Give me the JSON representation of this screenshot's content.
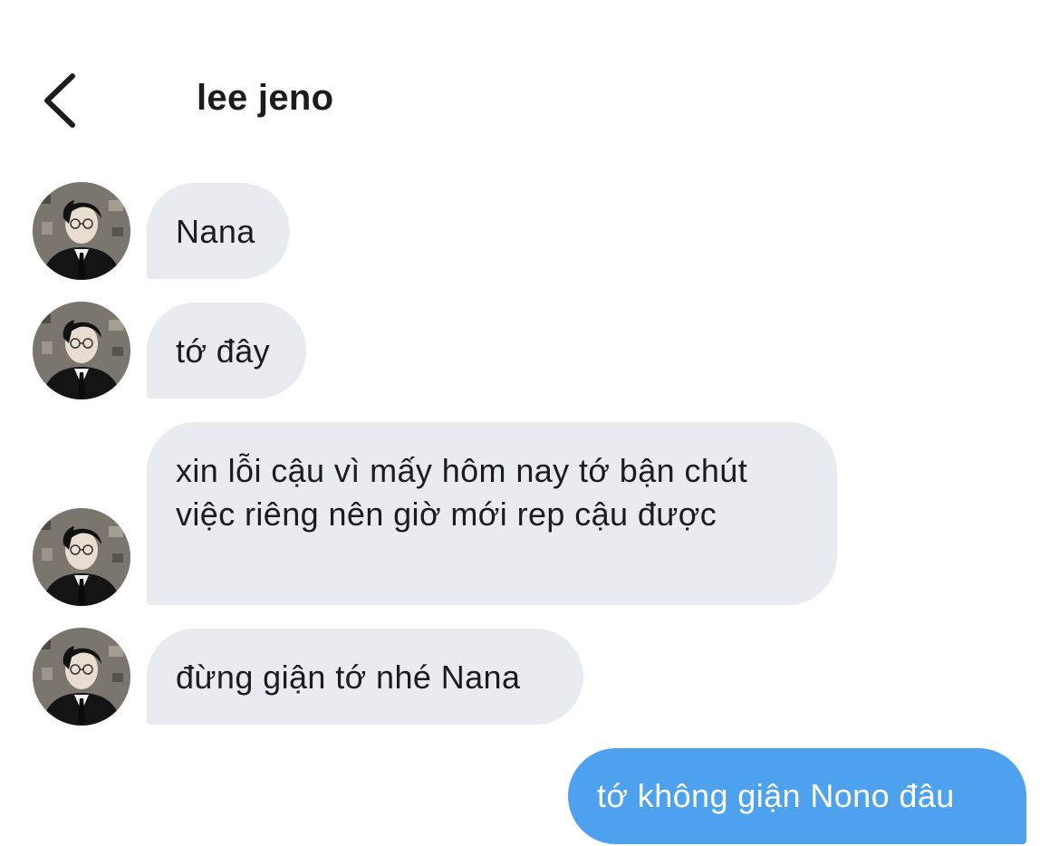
{
  "header": {
    "back_icon": "chevron-left-icon",
    "contact_name": "lee jeno"
  },
  "messages": [
    {
      "from": "contact",
      "text": "Nana",
      "avatar": "avatar-photo"
    },
    {
      "from": "contact",
      "text": "tớ đây",
      "avatar": "avatar-photo"
    },
    {
      "from": "contact",
      "text": "xin lỗi cậu vì mấy hôm nay tớ bận chút việc riêng nên giờ mới rep cậu được",
      "avatar": "avatar-photo"
    },
    {
      "from": "contact",
      "text": "đừng giận tớ nhé Nana",
      "avatar": "avatar-photo"
    },
    {
      "from": "me",
      "text": "tớ không giận Nono đâu"
    }
  ],
  "colors": {
    "incoming_bubble": "#e8ebf0",
    "outgoing_bubble": "#4ea1ee",
    "text": "#1c1c1e",
    "background": "#ffffff"
  }
}
